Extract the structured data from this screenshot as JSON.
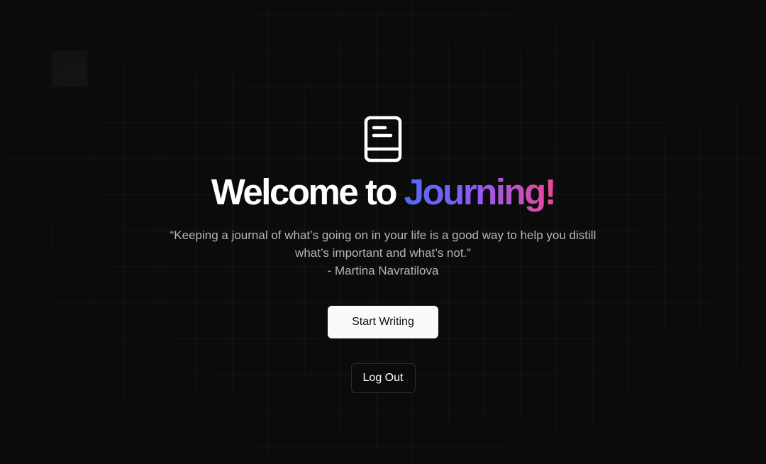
{
  "title": {
    "prefix": "Welcome to ",
    "brand": "Journing!"
  },
  "quote": {
    "text": "“Keeping a journal of what’s going on in your life is a good way to help you distill what’s important and what’s not.”",
    "author": "- Martina Navratilova"
  },
  "actions": {
    "start_label": "Start Writing",
    "logout_label": "Log Out"
  },
  "icons": {
    "logo": "book-icon"
  },
  "colors": {
    "background": "#0b0b0c",
    "brand_gradient_start": "#4f6af6",
    "brand_gradient_mid": "#8b5cf6",
    "brand_gradient_end": "#ec4899",
    "primary_button_bg": "#fafafa"
  }
}
